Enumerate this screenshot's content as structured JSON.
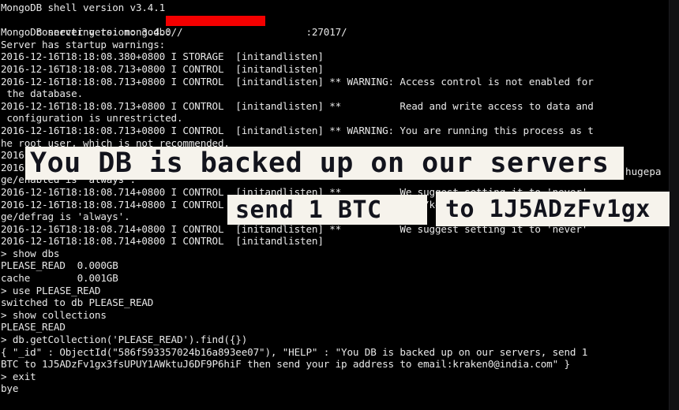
{
  "terminal": {
    "background_color": "#000000",
    "text_color": "#e8e8e8",
    "redaction_color": "#f40000",
    "lines": [
      "MongoDB shell version v3.4.1",
      "connecting to: mongodb://                     :27017/",
      "MongoDB server version: 3.4.0",
      "Server has startup warnings:",
      "2016-12-16T18:18:08.380+0800 I STORAGE  [initandlisten]",
      "2016-12-16T18:18:08.713+0800 I CONTROL  [initandlisten]",
      "2016-12-16T18:18:08.713+0800 I CONTROL  [initandlisten] ** WARNING: Access control is not enabled for",
      " the database.",
      "2016-12-16T18:18:08.713+0800 I CONTROL  [initandlisten] **          Read and write access to data and",
      " configuration is unrestricted.",
      "2016-12-16T18:18:08.713+0800 I CONTROL  [initandlisten] ** WARNING: You are running this process as t",
      "he root user, which is not recommended.",
      "2016-12-16T18:18:08.714+0800 I CONTROL  [initandlisten]",
      "2016-12-16T18:18:08.714+0800 I CONTROL  [initandlisten] ** WARNING: /sys/kernel/mm/transparent_hugepa",
      "ge/enabled is 'always'.",
      "2016-12-16T18:18:08.714+0800 I CONTROL  [initandlisten] **          We suggest setting it to 'never'",
      "2016-12-16T18:18:08.714+0800 I CONTROL  [initandlisten] ** WARNING: /sys/kernel/mm/transparent_hugepa",
      "ge/defrag is 'always'.",
      "2016-12-16T18:18:08.714+0800 I CONTROL  [initandlisten] **          We suggest setting it to 'never'",
      "2016-12-16T18:18:08.714+0800 I CONTROL  [initandlisten]",
      "> show dbs",
      "PLEASE_READ  0.000GB",
      "cache        0.001GB",
      "> use PLEASE_READ",
      "switched to db PLEASE_READ",
      "> show collections",
      "PLEASE_READ",
      "> db.getCollection('PLEASE_READ').find({})",
      "{ \"_id\" : ObjectId(\"586f593357024b16a893ee07\"), \"HELP\" : \"You DB is backed up on our servers, send 1",
      "BTC to 1J5ADzFv1gx3fsUPUY1AWktuJ6DF9P6hiF then send your ip address to email:kraken0@india.com\" }",
      "> exit",
      "bye"
    ],
    "redacted_host_line_index": 1
  },
  "overlay": {
    "background_color": "#f6f3ec",
    "text_color": "#12131c",
    "line1": "You DB is backed up on our servers",
    "line2a": "send 1 BTC",
    "line2b": "to 1J5ADzFv1gx",
    "peek_fragment": "hugepa"
  }
}
